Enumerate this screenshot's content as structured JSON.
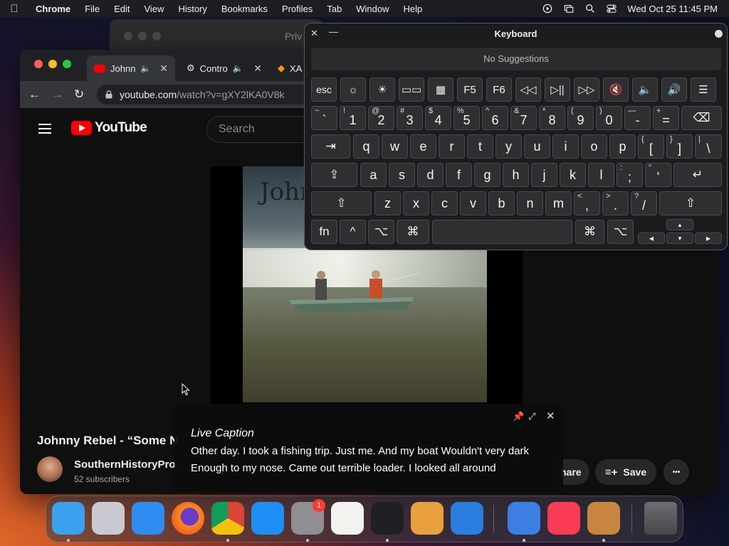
{
  "menubar": {
    "app": "Chrome",
    "items": [
      "File",
      "Edit",
      "View",
      "History",
      "Bookmarks",
      "Profiles",
      "Tab",
      "Window",
      "Help"
    ],
    "clock": "Wed Oct 25  11:45 PM"
  },
  "back_window": {
    "tab": "Priv"
  },
  "chrome": {
    "tabs": [
      {
        "label": "Johnn"
      },
      {
        "label": "Contro"
      },
      {
        "label": "XA"
      }
    ],
    "url_host": "youtube.com",
    "url_path": "/watch?v=gXY2lKA0V8k"
  },
  "youtube": {
    "logo": "YouTube",
    "search_placeholder": "Search",
    "video_overlay_title": "Johnn",
    "video_title": "Johnny Rebel - “Some N",
    "channel": "SouthernHistoryPro",
    "subscribers": "52 subscribers",
    "share_label": "hare",
    "save_label": "Save",
    "more_label": "•••"
  },
  "keyboard": {
    "title": "Keyboard",
    "suggestions": "No Suggestions",
    "row_fn": [
      "esc",
      "☼",
      "☀",
      "▭▭",
      "▦",
      "F5",
      "F6",
      "◁◁",
      "▷||",
      "▷▷",
      "🔇",
      "🔈",
      "🔊",
      "☰"
    ],
    "row_num": [
      {
        "sup": "~",
        "main": "`"
      },
      {
        "sup": "!",
        "main": "1"
      },
      {
        "sup": "@",
        "main": "2"
      },
      {
        "sup": "#",
        "main": "3"
      },
      {
        "sup": "$",
        "main": "4"
      },
      {
        "sup": "%",
        "main": "5"
      },
      {
        "sup": "^",
        "main": "6"
      },
      {
        "sup": "&",
        "main": "7"
      },
      {
        "sup": "*",
        "main": "8"
      },
      {
        "sup": "(",
        "main": "9"
      },
      {
        "sup": ")",
        "main": "0"
      },
      {
        "sup": "—",
        "main": "-"
      },
      {
        "sup": "+",
        "main": "="
      }
    ],
    "delete": "⌫",
    "tab": "⇥",
    "row_q": [
      "q",
      "w",
      "e",
      "r",
      "t",
      "y",
      "u",
      "i",
      "o",
      "p"
    ],
    "row_q_extra": [
      {
        "sup": "{",
        "main": "["
      },
      {
        "sup": "}",
        "main": "]"
      },
      {
        "sup": "|",
        "main": "\\"
      }
    ],
    "caps": "⇪",
    "row_a": [
      "a",
      "s",
      "d",
      "f",
      "g",
      "h",
      "j",
      "k",
      "l"
    ],
    "row_a_extra": [
      {
        "sup": ":",
        "main": ";"
      },
      {
        "sup": "\"",
        "main": "'"
      }
    ],
    "return": "↵",
    "shift": "⇧",
    "row_z": [
      "z",
      "x",
      "c",
      "v",
      "b",
      "n",
      "m"
    ],
    "row_z_extra": [
      {
        "sup": "<",
        "main": ","
      },
      {
        "sup": ">",
        "main": "."
      },
      {
        "sup": "?",
        "main": "/"
      }
    ],
    "bottom": {
      "fn": "fn",
      "ctrl": "^",
      "opt": "⌥",
      "cmd": "⌘"
    },
    "arrows": {
      "up": "▲",
      "left": "◀",
      "down": "▼",
      "right": "▶"
    }
  },
  "live_caption": {
    "title": "Live Caption",
    "text": "Other day. I took a fishing trip. Just me. And my boat Wouldn't very dark Enough to my nose. Came out terrible loader. I looked all around"
  },
  "dock": {
    "badge": "1",
    "apps": [
      "finder-icon",
      "launchpad-icon",
      "safari-icon",
      "firefox-icon",
      "chrome-icon",
      "app-store-icon",
      "system-settings-icon",
      "textedit-icon",
      "terminal-icon",
      "garageband-icon",
      "vscode-icon",
      "weather-icon",
      "music-icon",
      "archive-utility-icon",
      "trash-icon"
    ]
  }
}
